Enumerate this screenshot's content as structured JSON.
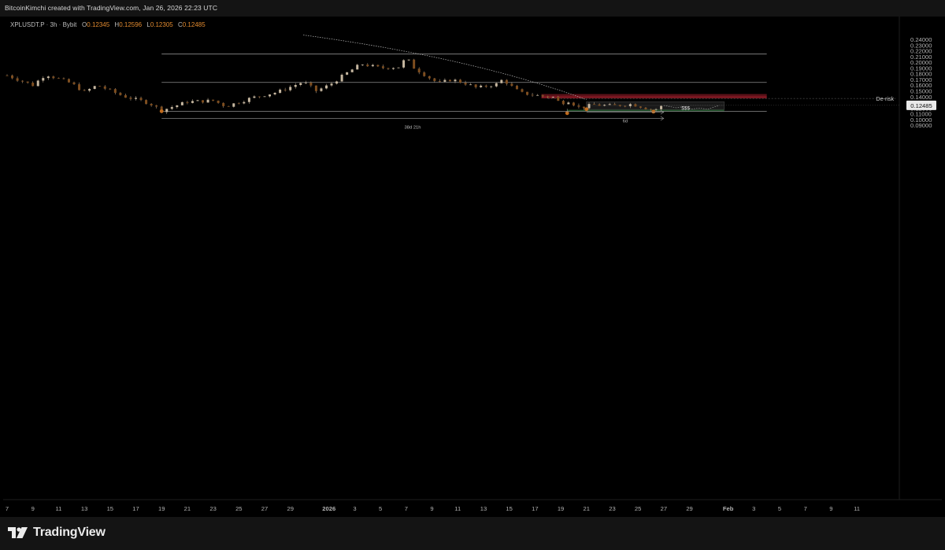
{
  "header": {
    "credit": "BitcoinKimchi created with TradingView.com, Jan 26, 2026 22:23 UTC"
  },
  "legend": {
    "symbol": "XPLUSDT.P",
    "interval": "3h",
    "exchange": "Bybit",
    "open_label": "O",
    "open": "0.12345",
    "high_label": "H",
    "high": "0.12596",
    "low_label": "L",
    "low": "0.12305",
    "close_label": "C",
    "close": "0.12485"
  },
  "brand": {
    "name": "TradingView",
    "icon": "tradingview-logo-icon"
  },
  "colors": {
    "background": "#000000",
    "frame": "#141414",
    "candle_up": "#c6b7a0",
    "candle_down": "#7f4e1f",
    "wick": "#a99a86",
    "accent_orange": "#e28a2f",
    "zone_red": "#7a1720",
    "zone_green": "#1f5a2a",
    "range_box": "#2e2e2e",
    "level_line": "#8c8c8c"
  },
  "chart_data": {
    "type": "candlestick",
    "title": "",
    "symbol": "XPLUSDT.P",
    "interval": "3h",
    "y_axis": {
      "ticks": [
        0.09,
        0.1,
        0.11,
        0.12,
        0.13,
        0.14,
        0.15,
        0.16,
        0.17,
        0.18,
        0.19,
        0.2,
        0.21,
        0.22,
        0.23,
        0.24
      ],
      "tick_labels": [
        "0.09000",
        "0.10000",
        "0.11000",
        "0.12000",
        "0.13000",
        "0.14000",
        "0.15000",
        "0.16000",
        "0.17000",
        "0.18000",
        "0.19000",
        "0.20000",
        "0.21000",
        "0.22000",
        "0.23000",
        "0.24000"
      ],
      "range": [
        0.083,
        0.2475
      ],
      "last_price_label": "0.12485",
      "last_price": 0.12485
    },
    "x_axis": {
      "labels": [
        "7",
        "9",
        "11",
        "13",
        "15",
        "17",
        "19",
        "21",
        "23",
        "25",
        "27",
        "29",
        "2026",
        "3",
        "5",
        "7",
        "9",
        "11",
        "13",
        "15",
        "17",
        "19",
        "21",
        "23",
        "25",
        "27",
        "29",
        "Feb",
        "3",
        "5",
        "7",
        "9",
        "11"
      ],
      "day_index": [
        0,
        2,
        4,
        6,
        8,
        10,
        12,
        14,
        16,
        18,
        20,
        22,
        25,
        27,
        29,
        31,
        33,
        35,
        37,
        39,
        41,
        43,
        45,
        47,
        49,
        51,
        53,
        56,
        58,
        60,
        62,
        64,
        66
      ],
      "note": "day_index counts days from the first axis label (Dec 7)"
    },
    "price_path": [
      {
        "day": 0,
        "price": 0.177
      },
      {
        "day": 2,
        "price": 0.16
      },
      {
        "day": 3,
        "price": 0.179
      },
      {
        "day": 5,
        "price": 0.163
      },
      {
        "day": 6,
        "price": 0.148
      },
      {
        "day": 7,
        "price": 0.16
      },
      {
        "day": 9,
        "price": 0.141
      },
      {
        "day": 11,
        "price": 0.129
      },
      {
        "day": 12,
        "price": 0.116
      },
      {
        "day": 14,
        "price": 0.131
      },
      {
        "day": 16,
        "price": 0.133
      },
      {
        "day": 17,
        "price": 0.123
      },
      {
        "day": 19,
        "price": 0.138
      },
      {
        "day": 21,
        "price": 0.148
      },
      {
        "day": 23,
        "price": 0.166
      },
      {
        "day": 24,
        "price": 0.15
      },
      {
        "day": 25,
        "price": 0.16
      },
      {
        "day": 26.5,
        "price": 0.183
      },
      {
        "day": 27.5,
        "price": 0.197
      },
      {
        "day": 29,
        "price": 0.19
      },
      {
        "day": 30.5,
        "price": 0.192
      },
      {
        "day": 31,
        "price": 0.209
      },
      {
        "day": 31.5,
        "price": 0.192
      },
      {
        "day": 32.5,
        "price": 0.177
      },
      {
        "day": 33.5,
        "price": 0.163
      },
      {
        "day": 34.5,
        "price": 0.17
      },
      {
        "day": 35.5,
        "price": 0.164
      },
      {
        "day": 36.5,
        "price": 0.155
      },
      {
        "day": 38,
        "price": 0.162
      },
      {
        "day": 38.5,
        "price": 0.17
      },
      {
        "day": 39.5,
        "price": 0.152
      },
      {
        "day": 40,
        "price": 0.146
      },
      {
        "day": 41.5,
        "price": 0.141
      },
      {
        "day": 42.5,
        "price": 0.139
      },
      {
        "day": 43,
        "price": 0.127
      },
      {
        "day": 43.5,
        "price": 0.134
      },
      {
        "day": 44.5,
        "price": 0.12
      },
      {
        "day": 45.5,
        "price": 0.126
      },
      {
        "day": 47,
        "price": 0.124
      },
      {
        "day": 48.5,
        "price": 0.127
      },
      {
        "day": 49.5,
        "price": 0.121
      },
      {
        "day": 50.2,
        "price": 0.116
      },
      {
        "day": 51,
        "price": 0.12485
      }
    ],
    "horizontal_levels": [
      {
        "price": 0.2143,
        "from_day": 12,
        "to_day": 59
      },
      {
        "price": 0.1648,
        "from_day": 12,
        "to_day": 59
      },
      {
        "price": 0.1145,
        "from_day": 12,
        "to_day": 59
      },
      {
        "price": 0.1368,
        "from_day": 42,
        "to_day": 69,
        "label": "De-risk"
      }
    ],
    "trendline": {
      "from": {
        "day": 23,
        "price": 0.2475
      },
      "to": {
        "day": 45,
        "price": 0.1345
      }
    },
    "zones": [
      {
        "kind": "supply",
        "color": "red",
        "from_day": 41.5,
        "to_day": 59,
        "price_top": 0.1445,
        "price_bottom": 0.137
      },
      {
        "kind": "range",
        "from_day": 45,
        "to_day": 55.7,
        "price_top": 0.131,
        "price_bottom": 0.1175
      },
      {
        "kind": "demand",
        "color": "green",
        "from_day": 43.5,
        "to_day": 55.7,
        "price_top": 0.117,
        "price_bottom": 0.1138
      }
    ],
    "range_mid_price": 0.1245,
    "liquidity_label": "$$$",
    "pivot_lows": [
      {
        "day": 12,
        "price": 0.1145
      },
      {
        "day": 43.5,
        "price": 0.1111
      },
      {
        "day": 45,
        "price": 0.118
      },
      {
        "day": 50.2,
        "price": 0.1138
      }
    ],
    "measurements": [
      {
        "label": "6d",
        "from_day": 45,
        "to_day": 51,
        "price": 0.1128
      },
      {
        "label": "38d 21h",
        "from_day": 12,
        "to_day": 51,
        "price": 0.102
      }
    ],
    "projection_path": [
      {
        "day": 51,
        "price": 0.1245
      },
      {
        "day": 52,
        "price": 0.1205
      },
      {
        "day": 52.5,
        "price": 0.1225
      },
      {
        "day": 53.2,
        "price": 0.1185
      },
      {
        "day": 53.8,
        "price": 0.12
      },
      {
        "day": 54.4,
        "price": 0.118
      },
      {
        "day": 55.3,
        "price": 0.1245
      }
    ]
  }
}
